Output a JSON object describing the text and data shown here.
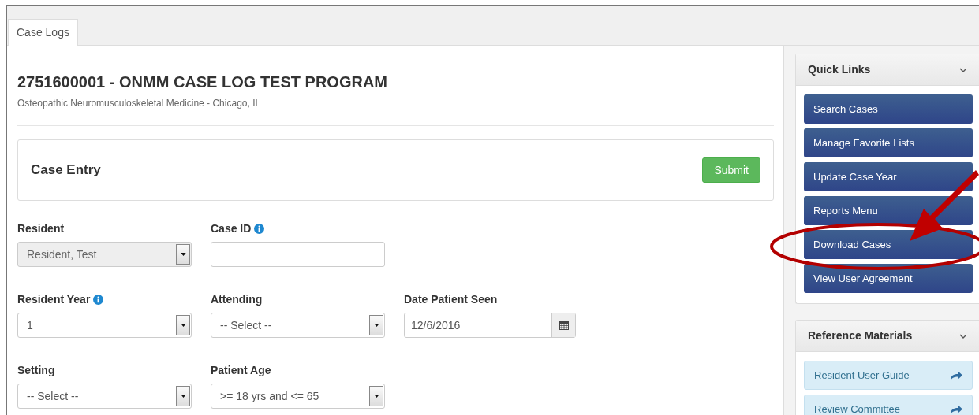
{
  "tabs": [
    {
      "label": "Case Logs",
      "selected": true
    }
  ],
  "program": {
    "title": "2751600001 - ONMM CASE LOG TEST PROGRAM",
    "subtitle": "Osteopathic Neuromusculoskeletal Medicine - Chicago, IL"
  },
  "case_entry": {
    "title": "Case Entry",
    "submit_button": "Submit"
  },
  "form_rows": [
    [
      {
        "label": "Resident",
        "info": false,
        "kind": "select",
        "value": "Resident, Test",
        "disabled": true
      },
      {
        "label": "Case ID",
        "info": true,
        "kind": "input",
        "disabled": false
      }
    ],
    [
      {
        "label": "Resident Year",
        "info": true,
        "kind": "select",
        "value": "1",
        "disabled": false
      },
      {
        "label": "Attending",
        "info": false,
        "kind": "select",
        "value": "-- Select --",
        "disabled": false
      },
      {
        "label": "Date Patient Seen",
        "info": false,
        "kind": "date",
        "value": "12/6/2016",
        "disabled": false
      }
    ],
    [
      {
        "label": "Setting",
        "info": false,
        "kind": "select",
        "value": "-- Select --",
        "disabled": false
      },
      {
        "label": "Patient Age",
        "info": false,
        "kind": "select",
        "value": ">= 18 yrs and <= 65",
        "disabled": false
      }
    ]
  ],
  "sidebar": {
    "panels": [
      {
        "title": "Quick Links",
        "kind": "nav",
        "items": [
          {
            "label": "Search Cases"
          },
          {
            "label": "Manage Favorite Lists"
          },
          {
            "label": "Update Case Year"
          },
          {
            "label": "Reports Menu"
          },
          {
            "label": "Download Cases"
          },
          {
            "label": "View User Agreement"
          }
        ]
      },
      {
        "title": "Reference Materials",
        "kind": "reference",
        "items": [
          {
            "label": "Resident User Guide"
          },
          {
            "label": "Review Committee"
          }
        ]
      }
    ]
  }
}
